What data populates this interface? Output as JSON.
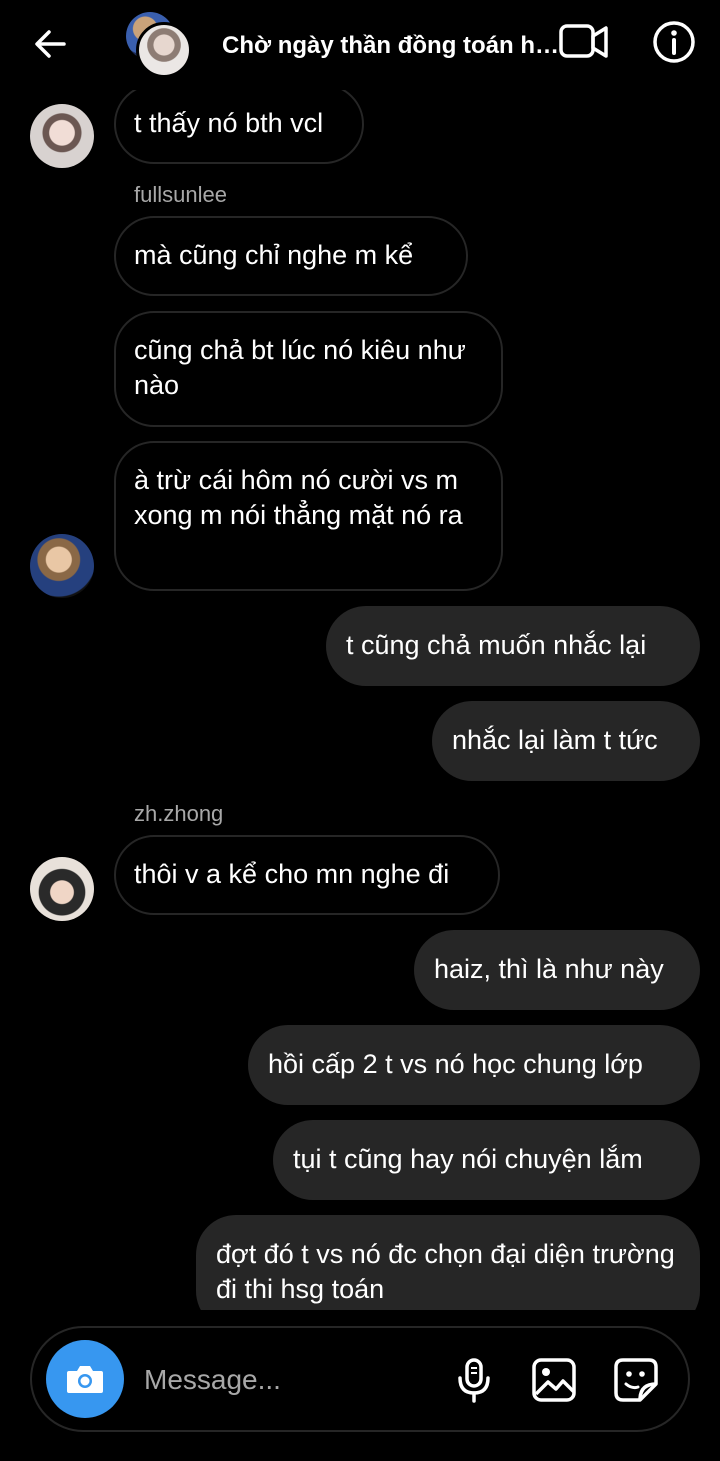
{
  "header": {
    "title": "Chờ ngày thần đồng toán h…"
  },
  "messages": {
    "m1": "t thấy nó bth vcl",
    "sender_fullsunlee": "fullsunlee",
    "m2": "mà cũng chỉ nghe m kể",
    "m3": "cũng chả bt lúc nó kiêu như nào",
    "m4": "à trừ cái hôm nó cười vs m xong m nói thẳng mặt nó ra",
    "m5": "t cũng chả muốn nhắc lại",
    "m6": "nhắc lại làm t tức",
    "sender_zhzhong": "zh.zhong",
    "m7": "thôi v a kể cho mn nghe đi",
    "m8": "haiz, thì là như này",
    "m9": "hồi cấp 2 t vs nó học chung lớp",
    "m10": "tụi t cũng hay nói chuyện lắm",
    "m11": "đợt đó t vs nó đc chọn đại diện trường đi thi hsg toán"
  },
  "composer": {
    "placeholder": "Message..."
  },
  "colors": {
    "background": "#000000",
    "outgoing_bubble": "#262626",
    "incoming_border": "#262626",
    "camera_button": "#3797f0",
    "secondary_text": "#a8a8a8"
  },
  "icons": {
    "back": "arrow-left-icon",
    "video": "video-camera-icon",
    "info": "info-icon",
    "camera": "camera-icon",
    "mic": "microphone-icon",
    "gallery": "image-icon",
    "sticker": "sticker-icon"
  }
}
